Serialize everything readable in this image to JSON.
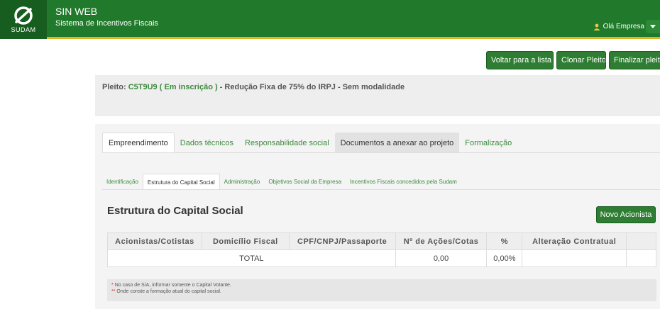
{
  "header": {
    "logo_text": "SUDAM",
    "app_title": "SIN WEB",
    "app_subtitle": "Sistema de Incentivos Fiscais",
    "user_greeting": "Olá Empresa",
    "colors": {
      "topbar": "#217a2b",
      "accent": "#e2b320"
    }
  },
  "actions": {
    "back": "Voltar para a lista",
    "clone": "Clonar Pleito",
    "finalize": "Finalizar pleito"
  },
  "pleito": {
    "prefix": "Pleito:",
    "code": "C5T9U9",
    "status": "( Em inscrição )",
    "description": "- Redução Fixa de 75% do IRPJ - Sem modalidade"
  },
  "tabs": [
    {
      "label": "Empreendimento"
    },
    {
      "label": "Dados técnicos"
    },
    {
      "label": "Responsabilidade social"
    },
    {
      "label": "Documentos a anexar ao projeto"
    },
    {
      "label": "Formalização"
    }
  ],
  "subtabs": [
    {
      "label": "Identificação"
    },
    {
      "label": "Estrutura do Capital Social"
    },
    {
      "label": "Administração"
    },
    {
      "label": "Objetivos Social da Empresa"
    },
    {
      "label": "Incentivos Fiscais concedidos pela Sudam"
    }
  ],
  "section": {
    "title": "Estrutura do Capital Social",
    "new_button": "Novo Acionista"
  },
  "table": {
    "columns": [
      "Acionistas/Cotistas",
      "Domicílio Fiscal",
      "CPF/CNPJ/Passaporte",
      "Nº de Ações/Cotas",
      "%",
      "Alteração Contratual",
      ""
    ],
    "total_label": "TOTAL",
    "total_shares": "0,00",
    "total_percent": "0,00%"
  },
  "notes": {
    "note1_mark": "*",
    "note1": "No caso de S/A, informar somente o Capital Votante.",
    "note2_mark": "**",
    "note2": "Onde conste a formação atual do capital social."
  }
}
